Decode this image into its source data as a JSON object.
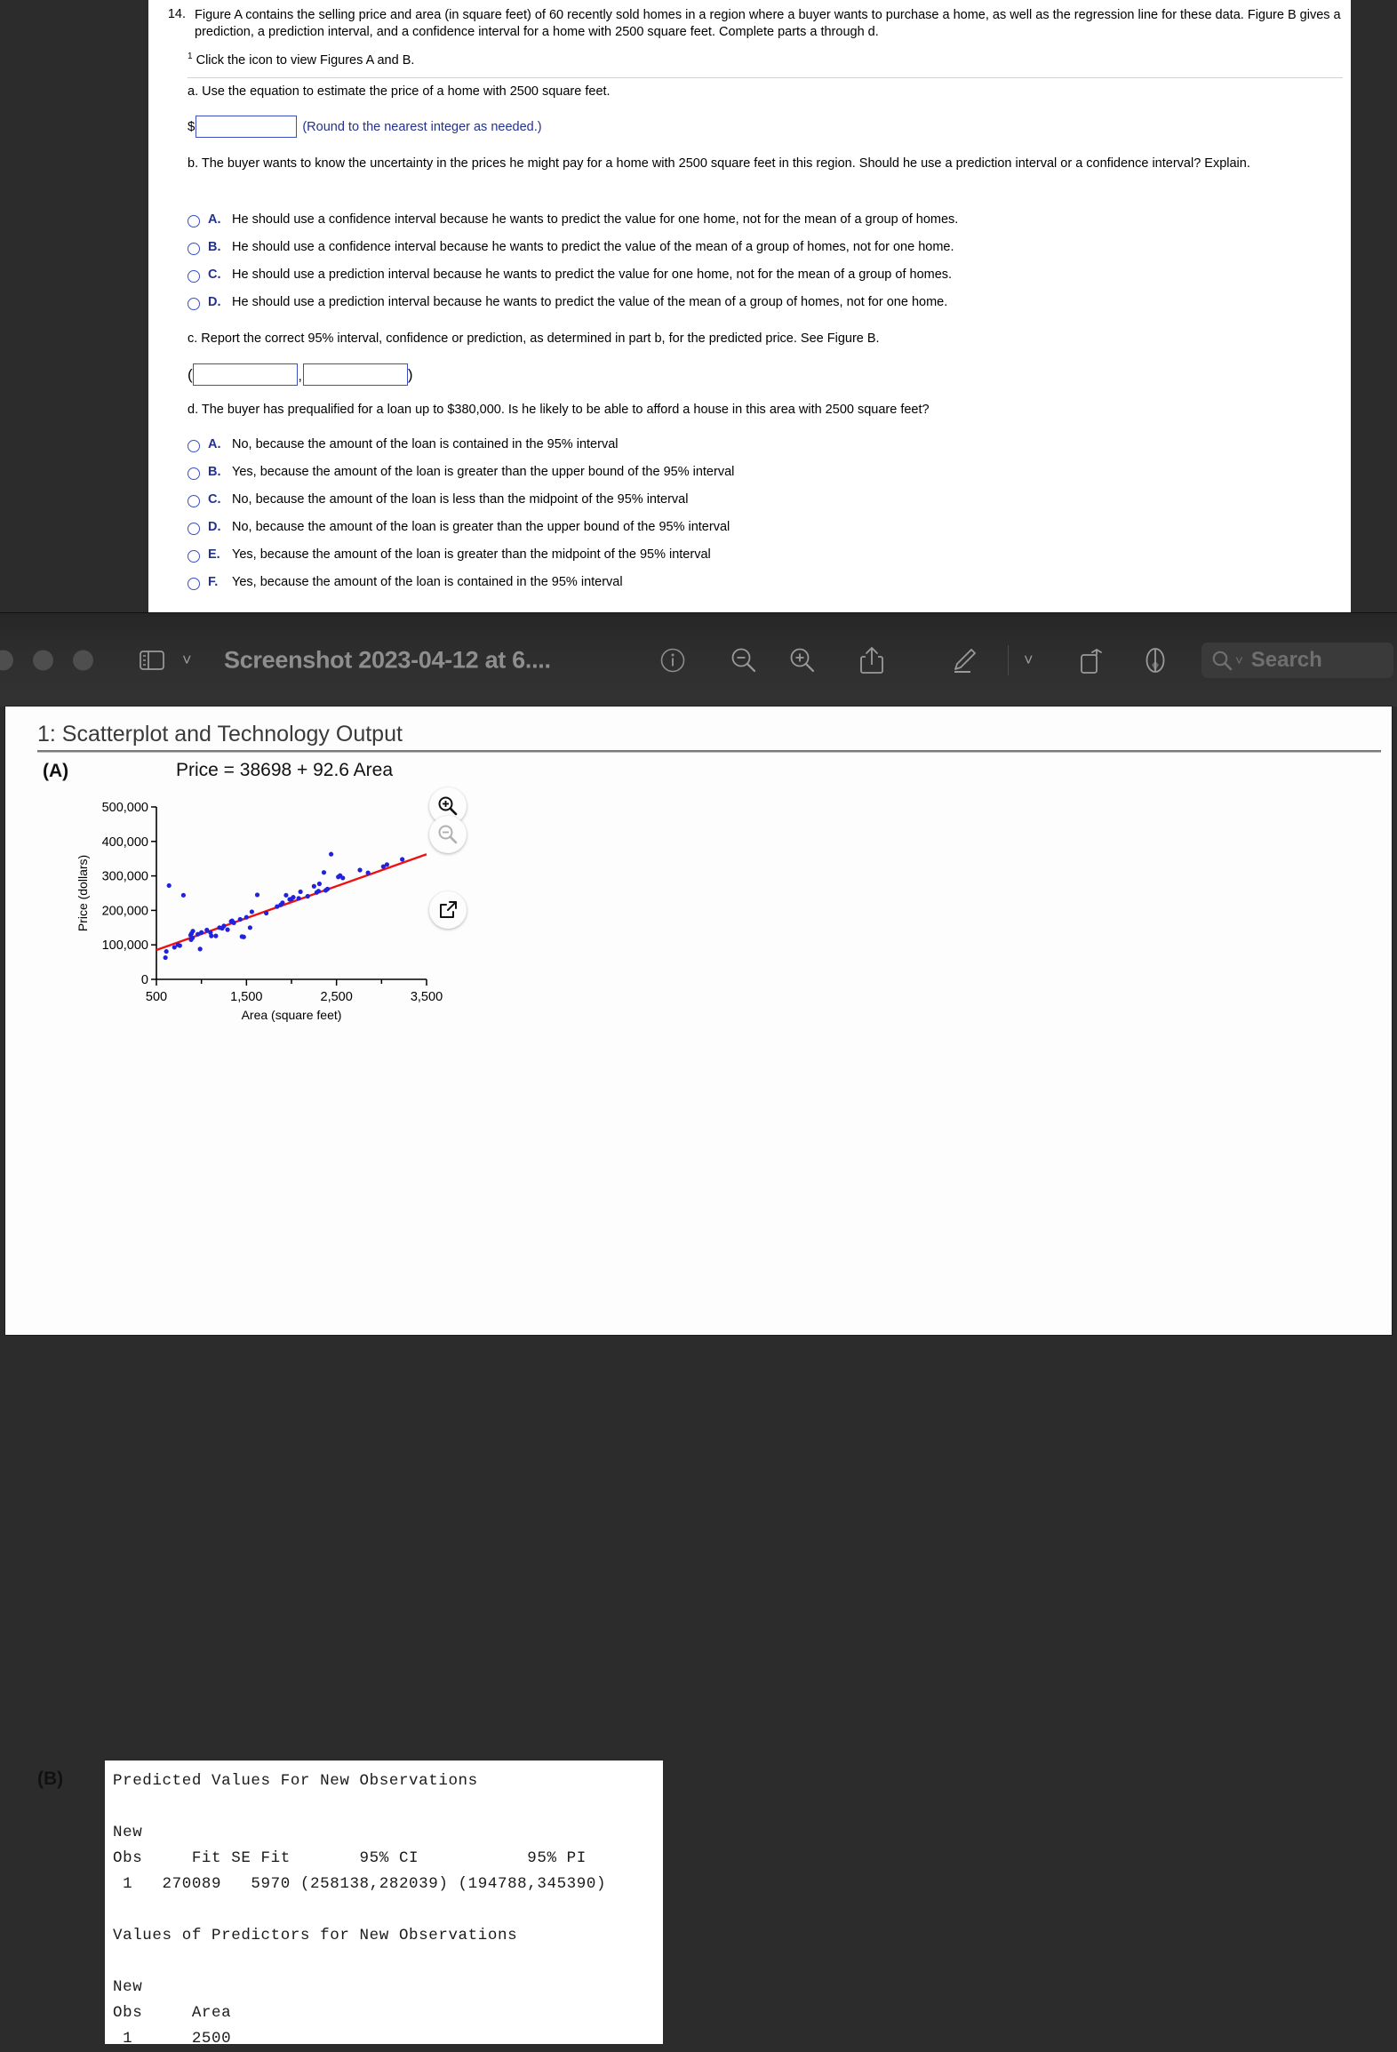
{
  "homework": {
    "question_number": "14.",
    "prompt": "Figure A contains the selling price and area (in square feet) of 60 recently sold homes in a region where a buyer wants to purchase a home, as well as the regression line for these data. Figure B gives a prediction, a prediction interval, and a confidence interval for a home with 2500 square feet. Complete parts a through d.",
    "footnote_marker": "1",
    "footnote": "Click the icon to view Figures A and B.",
    "part_a": {
      "text": "a. Use the equation to estimate the price of a home with 2500 square feet.",
      "dollar_sign": "$",
      "input_value": "",
      "input_placeholder": "",
      "hint": "(Round to the nearest integer as needed.)"
    },
    "part_b": {
      "text": "b. The buyer wants to know the uncertainty in the prices he might pay for a home with 2500 square feet in this region. Should he use a prediction interval or a confidence interval? Explain.",
      "options": [
        {
          "letter": "A.",
          "text": "He should use a confidence interval because he wants to predict the value for one home, not for the mean of a group of homes."
        },
        {
          "letter": "B.",
          "text": "He should use a confidence interval because he wants to predict the value of the mean of a group of homes, not for one home."
        },
        {
          "letter": "C.",
          "text": "He should use a prediction interval because he wants to predict the value for one home, not for the mean of a group of homes."
        },
        {
          "letter": "D.",
          "text": "He should use a prediction interval because he wants to predict the value of the mean of a group of homes, not for one home."
        }
      ]
    },
    "part_c": {
      "text": "c. Report the correct 95% interval, confidence or prediction, as determined in part b, for the predicted price. See Figure B.",
      "open_paren": "(",
      "comma": ",",
      "close_paren": ")",
      "lower_value": "",
      "upper_value": ""
    },
    "part_d": {
      "text": "d. The buyer has prequalified for a loan up to $380,000. Is he likely to be able to afford a house in this area with 2500 square feet?",
      "options": [
        {
          "letter": "A.",
          "text": "No, because the amount of the loan is contained in the 95% interval"
        },
        {
          "letter": "B.",
          "text": "Yes, because the amount of the loan is greater than the upper bound of the 95% interval"
        },
        {
          "letter": "C.",
          "text": "No, because the amount of the loan is less than the midpoint of the 95% interval"
        },
        {
          "letter": "D.",
          "text": "No, because the amount of the loan is greater than the upper bound of the 95% interval"
        },
        {
          "letter": "E.",
          "text": "Yes, because the amount of the loan is greater than the midpoint of the 95% interval"
        },
        {
          "letter": "F.",
          "text": "Yes, because the amount of the loan is contained in the 95% interval"
        }
      ]
    }
  },
  "toolbar": {
    "title": "Screenshot 2023-04-12 at 6....",
    "search_placeholder": "Search",
    "icons": {
      "sidebar": "sidebar-icon",
      "sidebar_chevron": "chevron-down-icon",
      "info": "info-circle-icon",
      "zoom_out": "zoom-out-icon",
      "zoom_in": "zoom-in-icon",
      "share": "share-icon",
      "markup": "markup-pen-icon",
      "markup_chevron": "chevron-down-icon",
      "rotate": "rotate-icon",
      "annotate": "annotate-pen-icon",
      "search": "search-icon"
    }
  },
  "figure_page": {
    "title": "1: Scatterplot and Technology Output",
    "panel_a_label": "(A)",
    "panel_b_label": "(B)",
    "equation": "Price = 38698 + 92.6 Area",
    "fab_zoom_in": "zoom-in-icon",
    "fab_zoom_out": "zoom-out-icon",
    "fab_expand": "open-in-new-icon",
    "tech_output": {
      "line1": "Predicted Values For New Observations",
      "line2": "New",
      "line3": "Obs     Fit SE Fit       95% CI           95% PI",
      "line4": " 1   270089   5970 (258138,282039) (194788,345390)",
      "line5": "Values of Predictors for New Observations",
      "line6": "New",
      "line7": "Obs     Area",
      "line8": " 1      2500",
      "values": {
        "obs": "1",
        "fit": "270089",
        "se_fit": "5970",
        "ci": "(258138,282039)",
        "pi": "(194788,345390)",
        "area": "2500"
      }
    }
  },
  "chart_data": {
    "type": "scatter",
    "title": "Price = 38698 + 92.6 Area",
    "xlabel": "Area (square feet)",
    "ylabel": "Price (dollars)",
    "xlim": [
      500,
      3500
    ],
    "ylim": [
      0,
      500000
    ],
    "xticks": [
      500,
      1500,
      2500,
      3500
    ],
    "xtick_labels": [
      "500",
      "1,500",
      "2,500",
      "3,500"
    ],
    "yticks": [
      0,
      100000,
      200000,
      300000,
      400000,
      500000
    ],
    "ytick_labels": [
      "0",
      "100,000",
      "200,000",
      "300,000",
      "400,000",
      "500,000"
    ],
    "grid": false,
    "legend": null,
    "point_color": "#2222dd",
    "line_color": "#ee1111",
    "regression_line": {
      "intercept": 38698,
      "slope": 92.6
    },
    "n_points": 60,
    "points": [
      [
        600,
        63000
      ],
      [
        610,
        81000
      ],
      [
        640,
        272000
      ],
      [
        700,
        93000
      ],
      [
        740,
        100000
      ],
      [
        760,
        98000
      ],
      [
        800,
        244000
      ],
      [
        880,
        128000
      ],
      [
        885,
        115000
      ],
      [
        890,
        133000
      ],
      [
        900,
        120000
      ],
      [
        905,
        140000
      ],
      [
        960,
        131000
      ],
      [
        985,
        88000
      ],
      [
        1000,
        136000
      ],
      [
        1060,
        143000
      ],
      [
        1100,
        136000
      ],
      [
        1110,
        126000
      ],
      [
        1160,
        126000
      ],
      [
        1200,
        150000
      ],
      [
        1230,
        148000
      ],
      [
        1250,
        155000
      ],
      [
        1290,
        144000
      ],
      [
        1330,
        168000
      ],
      [
        1340,
        170000
      ],
      [
        1360,
        164000
      ],
      [
        1430,
        174000
      ],
      [
        1450,
        124000
      ],
      [
        1470,
        123000
      ],
      [
        1500,
        180000
      ],
      [
        1540,
        150000
      ],
      [
        1560,
        196000
      ],
      [
        1620,
        245000
      ],
      [
        1720,
        192000
      ],
      [
        1840,
        211000
      ],
      [
        1880,
        216000
      ],
      [
        1900,
        222000
      ],
      [
        1940,
        244000
      ],
      [
        1980,
        232000
      ],
      [
        2000,
        233000
      ],
      [
        2020,
        238000
      ],
      [
        2080,
        235000
      ],
      [
        2100,
        254000
      ],
      [
        2180,
        241000
      ],
      [
        2250,
        270000
      ],
      [
        2280,
        252000
      ],
      [
        2300,
        256000
      ],
      [
        2310,
        277000
      ],
      [
        2360,
        310000
      ],
      [
        2380,
        258000
      ],
      [
        2400,
        262000
      ],
      [
        2440,
        363000
      ],
      [
        2520,
        297000
      ],
      [
        2540,
        301000
      ],
      [
        2570,
        294000
      ],
      [
        2760,
        317000
      ],
      [
        2850,
        309000
      ],
      [
        3020,
        327000
      ],
      [
        3060,
        333000
      ],
      [
        3230,
        348000
      ]
    ]
  }
}
